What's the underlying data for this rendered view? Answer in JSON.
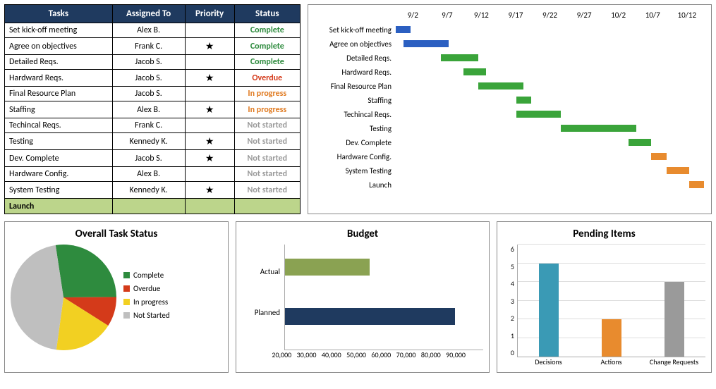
{
  "table": {
    "headers": [
      "Tasks",
      "Assigned To",
      "Priority",
      "Status"
    ],
    "rows": [
      {
        "task": "Set kick-off meeting",
        "assigned": "Alex B.",
        "priority": false,
        "status": "Complete"
      },
      {
        "task": "Agree on objectives",
        "assigned": "Frank C.",
        "priority": true,
        "status": "Complete"
      },
      {
        "task": "Detailed Reqs.",
        "assigned": "Jacob S.",
        "priority": false,
        "status": "Complete"
      },
      {
        "task": "Hardward Reqs.",
        "assigned": "Jacob S.",
        "priority": true,
        "status": "Overdue"
      },
      {
        "task": "Final Resource Plan",
        "assigned": "Jacob S.",
        "priority": false,
        "status": "In progress"
      },
      {
        "task": "Staffing",
        "assigned": "Alex B.",
        "priority": true,
        "status": "In progress"
      },
      {
        "task": "Techincal Reqs.",
        "assigned": "Frank C.",
        "priority": false,
        "status": "Not started"
      },
      {
        "task": "Testing",
        "assigned": "Kennedy K.",
        "priority": true,
        "status": "Not started"
      },
      {
        "task": "Dev. Complete",
        "assigned": "Jacob S.",
        "priority": true,
        "status": "Not started"
      },
      {
        "task": "Hardware Config.",
        "assigned": "Alex B.",
        "priority": false,
        "status": "Not started"
      },
      {
        "task": "System Testing",
        "assigned": "Kennedy K.",
        "priority": true,
        "status": "Not started"
      }
    ],
    "launch_label": "Launch"
  },
  "gantt": {
    "dates": [
      "9/2",
      "9/7",
      "9/12",
      "9/17",
      "9/22",
      "9/27",
      "10/2",
      "10/7",
      "10/12"
    ],
    "tasks": [
      "Set kick-off meeting",
      "Agree on objectives",
      "Detailed Reqs.",
      "Hardward Reqs.",
      "Final Resource Plan",
      "Staffing",
      "Techincal Reqs.",
      "Testing",
      "Dev. Complete",
      "Hardware Config.",
      "System Testing",
      "Launch"
    ]
  },
  "status_chart": {
    "title": "Overall Task Status",
    "legend": [
      {
        "label": "Complete",
        "color": "#2e8b3e"
      },
      {
        "label": "Overdue",
        "color": "#d43a1a"
      },
      {
        "label": "In progress",
        "color": "#f2d022"
      },
      {
        "label": "Not Started",
        "color": "#bfbfbf"
      }
    ]
  },
  "budget": {
    "title": "Budget",
    "labels": [
      "Actual",
      "Planned"
    ],
    "xaxis": [
      "20,000",
      "30,000",
      "40,000",
      "50,000",
      "60,000",
      "70,000",
      "80,000",
      "90,000"
    ]
  },
  "pending": {
    "title": "Pending Items",
    "yaxis": [
      "0",
      "1",
      "2",
      "3",
      "4",
      "5",
      "6"
    ],
    "xaxis": [
      "Decisions",
      "Actions",
      "Change Requests"
    ]
  },
  "chart_data": [
    {
      "type": "gantt",
      "title": "Project timeline",
      "x_ticks": [
        "9/2",
        "9/7",
        "9/12",
        "9/17",
        "9/22",
        "9/27",
        "10/2",
        "10/7",
        "10/12"
      ],
      "tasks": [
        {
          "name": "Set kick-off meeting",
          "start": "9/2",
          "end": "9/4",
          "color": "blue"
        },
        {
          "name": "Agree on objectives",
          "start": "9/3",
          "end": "9/9",
          "color": "blue"
        },
        {
          "name": "Detailed Reqs.",
          "start": "9/8",
          "end": "9/13",
          "color": "green"
        },
        {
          "name": "Hardward Reqs.",
          "start": "9/11",
          "end": "9/14",
          "color": "green"
        },
        {
          "name": "Final Resource Plan",
          "start": "9/13",
          "end": "9/19",
          "color": "green"
        },
        {
          "name": "Staffing",
          "start": "9/18",
          "end": "9/20",
          "color": "green"
        },
        {
          "name": "Techincal Reqs.",
          "start": "9/18",
          "end": "9/24",
          "color": "green"
        },
        {
          "name": "Testing",
          "start": "9/24",
          "end": "10/3",
          "color": "green"
        },
        {
          "name": "Dev. Complete",
          "start": "10/2",
          "end": "10/5",
          "color": "green"
        },
        {
          "name": "Hardware Config.",
          "start": "10/5",
          "end": "10/7",
          "color": "orange"
        },
        {
          "name": "System Testing",
          "start": "10/7",
          "end": "10/10",
          "color": "orange"
        },
        {
          "name": "Launch",
          "start": "10/10",
          "end": "10/12",
          "color": "orange"
        }
      ]
    },
    {
      "type": "pie",
      "title": "Overall Task Status",
      "series": [
        {
          "name": "Complete",
          "value": 3,
          "color": "#2e8b3e"
        },
        {
          "name": "Overdue",
          "value": 1,
          "color": "#d43a1a"
        },
        {
          "name": "In progress",
          "value": 2,
          "color": "#f2d022"
        },
        {
          "name": "Not Started",
          "value": 5,
          "color": "#bfbfbf"
        }
      ]
    },
    {
      "type": "bar",
      "orientation": "horizontal",
      "title": "Budget",
      "categories": [
        "Actual",
        "Planned"
      ],
      "values": [
        50000,
        80000
      ],
      "colors": [
        "#8aa252",
        "#1f3a5f"
      ],
      "xlim": [
        20000,
        90000
      ]
    },
    {
      "type": "bar",
      "title": "Pending Items",
      "categories": [
        "Decisions",
        "Actions",
        "Change Requests"
      ],
      "values": [
        5,
        2,
        4
      ],
      "colors": [
        "#3a9ab5",
        "#e88b2e",
        "#9a9a9a"
      ],
      "ylim": [
        0,
        6
      ]
    }
  ]
}
